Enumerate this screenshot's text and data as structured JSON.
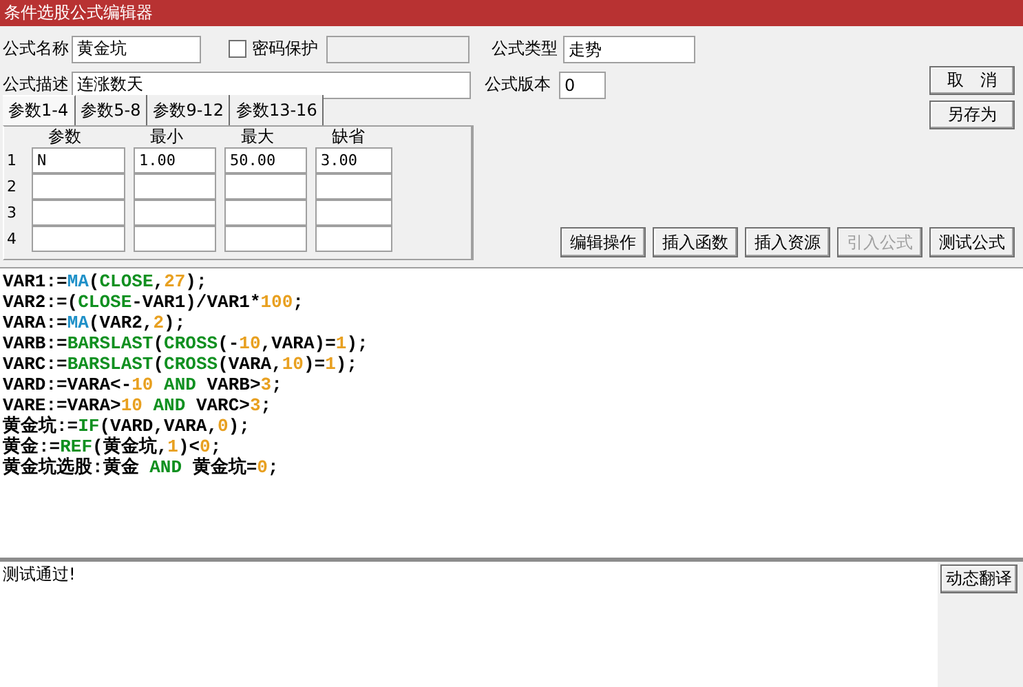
{
  "window": {
    "title": "条件选股公式编辑器"
  },
  "form": {
    "name_label": "公式名称",
    "name_value": "黄金坑",
    "password": {
      "label": "密码保护",
      "checked": false
    },
    "type_label": "公式类型",
    "type_value": "走势",
    "desc_label": "公式描述",
    "desc_value": "连涨数天",
    "version_label": "公式版本",
    "version_value": "0"
  },
  "side_buttons": [
    "取　消",
    "另存为"
  ],
  "param_tabs": [
    {
      "label": "参数1-4",
      "selected": true
    },
    {
      "label": "参数5-8",
      "selected": false
    },
    {
      "label": "参数9-12",
      "selected": false
    },
    {
      "label": "参数13-16",
      "selected": false
    }
  ],
  "param_table": {
    "columns": [
      "参数",
      "最小",
      "最大",
      "缺省"
    ],
    "rows": [
      {
        "index": "1",
        "cells": [
          "N",
          "1.00",
          "50.00",
          "3.00"
        ]
      },
      {
        "index": "2",
        "cells": []
      },
      {
        "index": "3",
        "cells": []
      },
      {
        "index": "4",
        "cells": []
      }
    ]
  },
  "toolbar": [
    {
      "label": "编辑操作",
      "disabled": false
    },
    {
      "label": "插入函数",
      "disabled": false
    },
    {
      "label": "插入资源",
      "disabled": false
    },
    {
      "label": "引入公式",
      "disabled": true
    },
    {
      "label": "测试公式",
      "disabled": false
    }
  ],
  "code": [
    [
      {
        "t": "VAR1:=",
        "kind": "plain"
      },
      {
        "t": "MA",
        "kind": "func"
      },
      {
        "t": "(",
        "kind": "plain"
      },
      {
        "t": "CLOSE",
        "kind": "kw"
      },
      {
        "t": ",",
        "kind": "plain"
      },
      {
        "t": "27",
        "kind": "num"
      },
      {
        "t": ");",
        "kind": "plain"
      }
    ],
    [
      {
        "t": "VAR2:=(",
        "kind": "plain"
      },
      {
        "t": "CLOSE",
        "kind": "kw"
      },
      {
        "t": "-VAR1)/VAR1*",
        "kind": "plain"
      },
      {
        "t": "100",
        "kind": "num"
      },
      {
        "t": ";",
        "kind": "plain"
      }
    ],
    [
      {
        "t": "VARA:=",
        "kind": "plain"
      },
      {
        "t": "MA",
        "kind": "func"
      },
      {
        "t": "(VAR2,",
        "kind": "plain"
      },
      {
        "t": "2",
        "kind": "num"
      },
      {
        "t": ");",
        "kind": "plain"
      }
    ],
    [
      {
        "t": "VARB:=",
        "kind": "plain"
      },
      {
        "t": "BARSLAST",
        "kind": "kw"
      },
      {
        "t": "(",
        "kind": "plain"
      },
      {
        "t": "CROSS",
        "kind": "kw"
      },
      {
        "t": "(-",
        "kind": "plain"
      },
      {
        "t": "10",
        "kind": "num"
      },
      {
        "t": ",VARA)=",
        "kind": "plain"
      },
      {
        "t": "1",
        "kind": "num"
      },
      {
        "t": ");",
        "kind": "plain"
      }
    ],
    [
      {
        "t": "VARC:=",
        "kind": "plain"
      },
      {
        "t": "BARSLAST",
        "kind": "kw"
      },
      {
        "t": "(",
        "kind": "plain"
      },
      {
        "t": "CROSS",
        "kind": "kw"
      },
      {
        "t": "(VARA,",
        "kind": "plain"
      },
      {
        "t": "10",
        "kind": "num"
      },
      {
        "t": ")=",
        "kind": "plain"
      },
      {
        "t": "1",
        "kind": "num"
      },
      {
        "t": ");",
        "kind": "plain"
      }
    ],
    [
      {
        "t": "VARD:=VARA<-",
        "kind": "plain"
      },
      {
        "t": "10",
        "kind": "num"
      },
      {
        "t": " AND ",
        "kind": "kw"
      },
      {
        "t": "VARB>",
        "kind": "plain"
      },
      {
        "t": "3",
        "kind": "num"
      },
      {
        "t": ";",
        "kind": "plain"
      }
    ],
    [
      {
        "t": "VARE:=VARA>",
        "kind": "plain"
      },
      {
        "t": "10",
        "kind": "num"
      },
      {
        "t": " AND ",
        "kind": "kw"
      },
      {
        "t": "VARC>",
        "kind": "plain"
      },
      {
        "t": "3",
        "kind": "num"
      },
      {
        "t": ";",
        "kind": "plain"
      }
    ],
    [
      {
        "t": "黄金坑:=",
        "kind": "plain"
      },
      {
        "t": "IF",
        "kind": "kw"
      },
      {
        "t": "(VARD,VARA,",
        "kind": "plain"
      },
      {
        "t": "0",
        "kind": "num"
      },
      {
        "t": ");",
        "kind": "plain"
      }
    ],
    [
      {
        "t": "黄金:=",
        "kind": "plain"
      },
      {
        "t": "REF",
        "kind": "kw"
      },
      {
        "t": "(黄金坑,",
        "kind": "plain"
      },
      {
        "t": "1",
        "kind": "num"
      },
      {
        "t": ")<",
        "kind": "plain"
      },
      {
        "t": "0",
        "kind": "num"
      },
      {
        "t": ";",
        "kind": "plain"
      }
    ],
    [
      {
        "t": "黄金坑选股:黄金 ",
        "kind": "plain"
      },
      {
        "t": "AND",
        "kind": "kw"
      },
      {
        "t": " 黄金坑=",
        "kind": "plain"
      },
      {
        "t": "0",
        "kind": "num"
      },
      {
        "t": ";",
        "kind": "plain"
      }
    ]
  ],
  "message": "测试通过!",
  "message_buttons": [
    "动态翻译"
  ]
}
